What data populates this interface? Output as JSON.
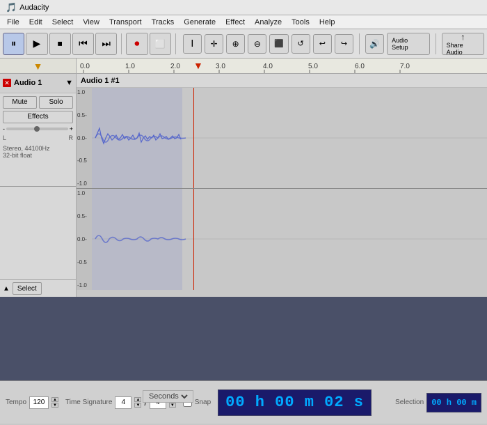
{
  "app": {
    "title": "Audacity",
    "icon": "🎵"
  },
  "menu": {
    "items": [
      "File",
      "Edit",
      "Select",
      "View",
      "Transport",
      "Tracks",
      "Generate",
      "Effect",
      "Analyze",
      "Tools",
      "Help"
    ]
  },
  "toolbar": {
    "pause_label": "⏸",
    "play_label": "▶",
    "stop_label": "⏹",
    "rewind_label": "⏮",
    "forward_label": "⏭",
    "record_label": "⏺",
    "clip_label": "⬜",
    "zoom_in": "🔍+",
    "zoom_out": "🔍-",
    "audio_setup_label": "Audio Setup",
    "share_audio_label": "Share Audio"
  },
  "ruler": {
    "markers": [
      "0.0",
      "1.0",
      "2.0",
      "3.0",
      "4.0",
      "5.0",
      "6.0",
      "7.0"
    ]
  },
  "track": {
    "name": "Audio 1",
    "clip_name": "Audio 1 #1",
    "mute_label": "Mute",
    "solo_label": "Solo",
    "effects_label": "Effects",
    "info": "Stereo, 44100Hz\n32-bit float",
    "select_label": "Select",
    "volume_min": "-",
    "volume_max": "+"
  },
  "bottom": {
    "tempo_label": "Tempo",
    "tempo_value": "120",
    "time_sig_label": "Time Signature",
    "time_sig_num": "4",
    "time_sig_den": "4",
    "snap_label": "Snap",
    "seconds_label": "Seconds",
    "time_display": "00 h 00 m 02 s",
    "selection_label": "Selection",
    "selection_time": "00 h 00 m"
  }
}
